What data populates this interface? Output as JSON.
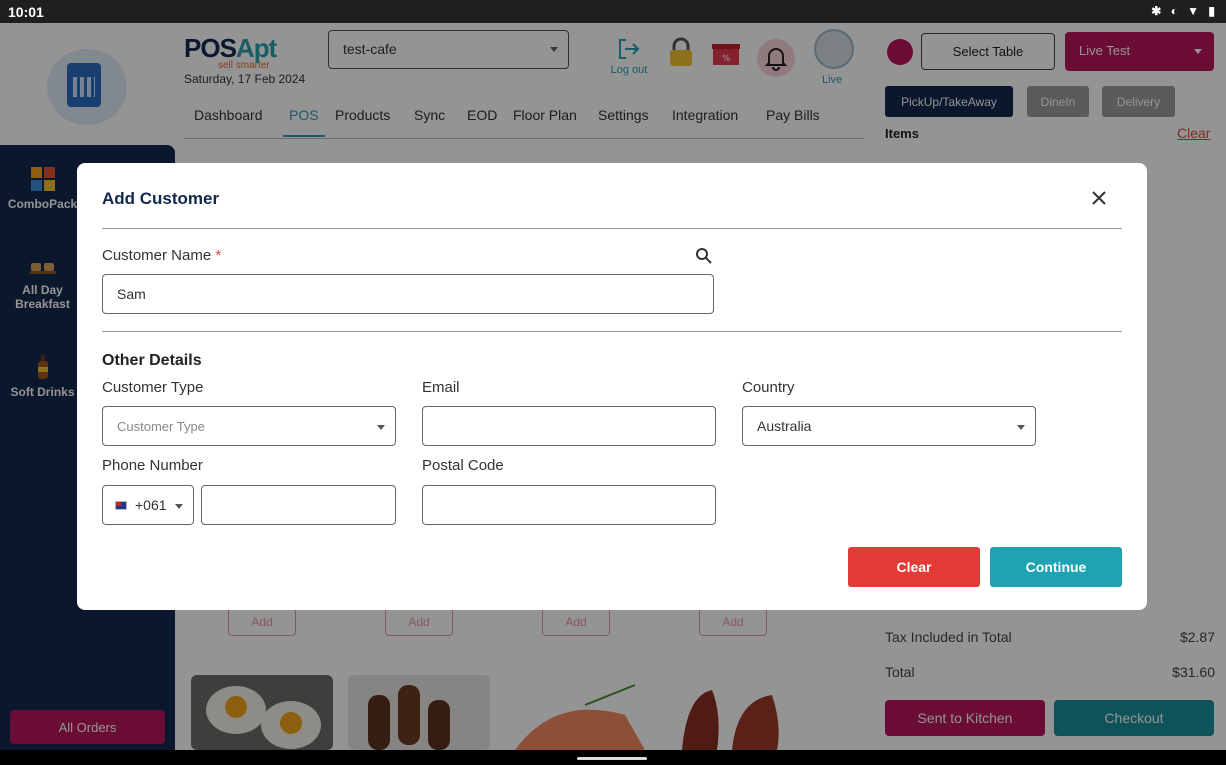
{
  "status_bar": {
    "time": "10:01",
    "icons": "✱ ◐ ▼ ▮"
  },
  "brand": {
    "name_a": "POS",
    "name_b": "Apt",
    "tagline": "sell smarter",
    "date": "Saturday, 17 Feb 2024"
  },
  "store": {
    "selected": "test-cafe"
  },
  "header": {
    "logout_label": "Log out",
    "avatar_label": "Live"
  },
  "nav": {
    "tabs": [
      "Dashboard",
      "POS",
      "Products",
      "Sync",
      "EOD",
      "Floor Plan",
      "Settings",
      "Integration",
      "Pay Bills"
    ],
    "active": "POS"
  },
  "categories": [
    {
      "label": "ComboPack"
    },
    {
      "label": "All Day Breakfast"
    },
    {
      "label": "Soft Drinks"
    }
  ],
  "all_orders_label": "All Orders",
  "products": {
    "add_label": "Add"
  },
  "right_panel": {
    "select_table": "Select Table",
    "account": "Live Test",
    "order_types": [
      "PickUp/TakeAway",
      "DineIn",
      "Delivery"
    ],
    "items_heading": "Items",
    "clear_label": "Clear",
    "tax_label": "Tax Included in Total",
    "tax_value": "$2.87",
    "total_label": "Total",
    "total_value": "$31.60",
    "sent_label": "Sent to Kitchen",
    "checkout_label": "Checkout"
  },
  "modal": {
    "title": "Add Customer",
    "customer_name_label": "Customer Name",
    "required_mark": "*",
    "customer_name_value": "Sam",
    "other_details_heading": "Other Details",
    "customer_type_label": "Customer Type",
    "customer_type_placeholder": "Customer Type",
    "email_label": "Email",
    "email_value": "",
    "country_label": "Country",
    "country_value": "Australia",
    "phone_label": "Phone Number",
    "phone_code": "+061",
    "phone_value": "",
    "postal_label": "Postal Code",
    "postal_value": "",
    "clear_button": "Clear",
    "continue_button": "Continue"
  },
  "colors": {
    "primary_navy": "#12284f",
    "accent_teal": "#1fa3b2",
    "brand_magenta": "#b8155a",
    "danger_red": "#e53935"
  }
}
